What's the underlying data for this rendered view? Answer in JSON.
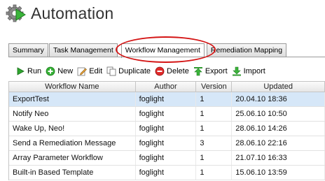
{
  "header": {
    "title": "Automation",
    "icon": "gear-icon"
  },
  "tabs": [
    {
      "label": "Summary",
      "active": false
    },
    {
      "label": "Task Management",
      "active": false
    },
    {
      "label": "Workflow Management",
      "active": true
    },
    {
      "label": "Remediation Mapping",
      "active": false
    }
  ],
  "toolbar": {
    "run": "Run",
    "new": "New",
    "edit": "Edit",
    "duplicate": "Duplicate",
    "delete": "Delete",
    "export": "Export",
    "import": "Import"
  },
  "table": {
    "columns": [
      "Workflow Name",
      "Author",
      "Version",
      "Updated"
    ],
    "rows": [
      {
        "name": "ExportTest",
        "author": "foglight",
        "version": "1",
        "updated": "20.04.10 18:36",
        "selected": true
      },
      {
        "name": "Notify Neo",
        "author": "foglight",
        "version": "1",
        "updated": "25.06.10 10:50",
        "selected": false
      },
      {
        "name": "Wake Up, Neo!",
        "author": "foglight",
        "version": "1",
        "updated": "28.06.10 14:26",
        "selected": false
      },
      {
        "name": "Send a Remediation Message",
        "author": "foglight",
        "version": "3",
        "updated": "28.06.10 22:16",
        "selected": false
      },
      {
        "name": "Array Parameter Workflow",
        "author": "foglight",
        "version": "1",
        "updated": "21.07.10 16:33",
        "selected": false
      },
      {
        "name": "Built-in Based Template",
        "author": "foglight",
        "version": "1",
        "updated": "15.06.10 13:59",
        "selected": false
      }
    ]
  },
  "colors": {
    "highlight": "#d41515",
    "selected_row": "#d6e7f8"
  }
}
